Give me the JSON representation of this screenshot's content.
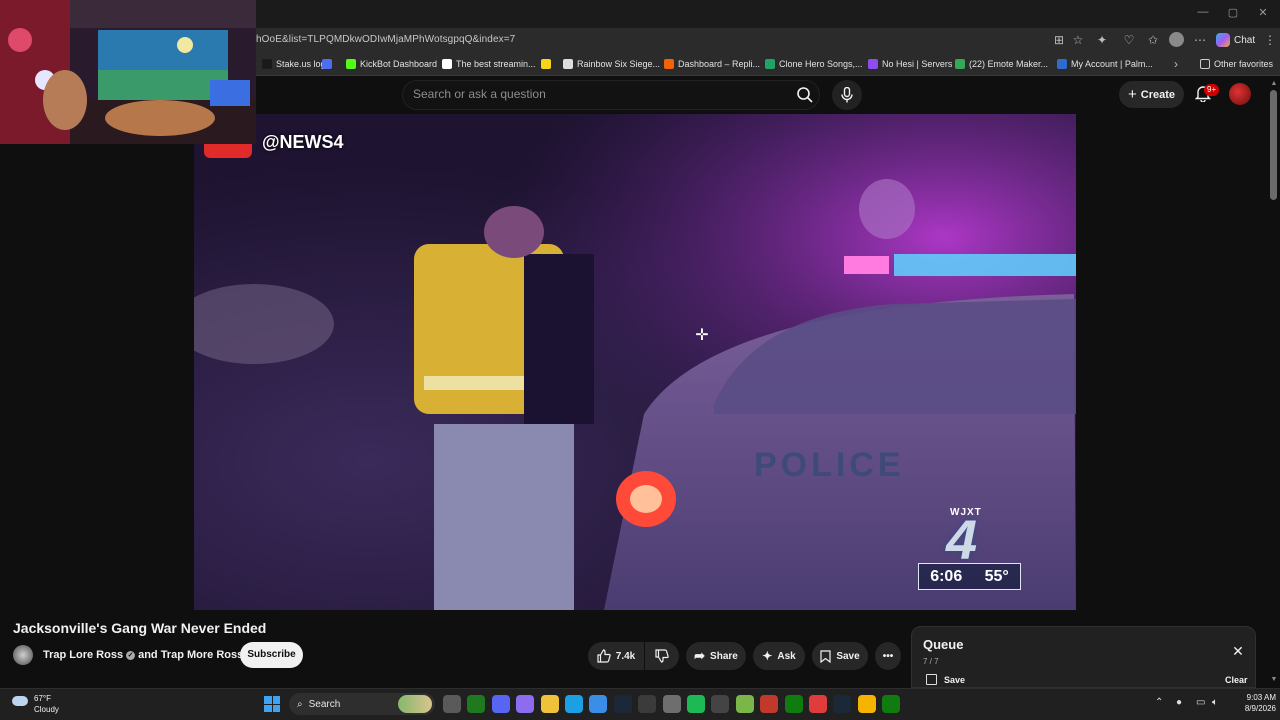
{
  "browser": {
    "url": "hOoE&list=TLPQMDkwODIwMjaMPhWotsgpqQ&index=7",
    "chat_label": "Chat",
    "bookmarks": [
      {
        "label": "Stake.us logo",
        "color": "#1a1a1a"
      },
      {
        "label": "",
        "color": "#4e6ef2"
      },
      {
        "label": "KickBot Dashboard",
        "color": "#53fc18"
      },
      {
        "label": "The best streamin...",
        "color": "#ffffff"
      },
      {
        "label": "",
        "color": "#f7d619"
      },
      {
        "label": "Rainbow Six Siege...",
        "color": "#dddddd"
      },
      {
        "label": "Dashboard – Repli...",
        "color": "#f26207"
      },
      {
        "label": "Clone Hero Songs,...",
        "color": "#21a366"
      },
      {
        "label": "No Hesi | Servers",
        "color": "#8f4cf0"
      },
      {
        "label": "(22) Emote Maker...",
        "color": "#34a853"
      },
      {
        "label": "My Account | Palm...",
        "color": "#2d6bd1"
      }
    ],
    "other_favorites": "Other favorites"
  },
  "youtube": {
    "search_placeholder": "Search or ask a question",
    "create_label": "Create",
    "notif_count": "9+",
    "video": {
      "news_handle": "@NEWS4",
      "station": "WJXT",
      "channel_num": "4",
      "time": "6:06",
      "temp": "55°"
    },
    "title": "Jacksonville's Gang War Never Ended",
    "channel": "Trap Lore Ross",
    "collab": "and Trap More Ross",
    "subscribe_label": "Subscribe",
    "likes": "7.4k",
    "share_label": "Share",
    "ask_label": "Ask",
    "save_label": "Save",
    "queue": {
      "title": "Queue",
      "count": "7 / 7",
      "save_label": "Save",
      "clear_label": "Clear"
    }
  },
  "taskbar": {
    "weather_temp": "67°F",
    "weather_cond": "Cloudy",
    "search_label": "Search",
    "time": "9:03 AM",
    "date": "8/9/2026",
    "apps": [
      {
        "name": "task-view",
        "color": "#5a5a5a"
      },
      {
        "name": "xbox-gamebar",
        "color": "#1f7a1f"
      },
      {
        "name": "discord",
        "color": "#5865f2"
      },
      {
        "name": "copilot",
        "color": "#8c6cf0"
      },
      {
        "name": "file-explorer",
        "color": "#f0c23a"
      },
      {
        "name": "edge",
        "color": "#1ba1e2"
      },
      {
        "name": "ms-store",
        "color": "#3a8ee6"
      },
      {
        "name": "steam",
        "color": "#1b2838"
      },
      {
        "name": "obs",
        "color": "#3b3b3b"
      },
      {
        "name": "settings",
        "color": "#6e6e6e"
      },
      {
        "name": "spotify",
        "color": "#1db954"
      },
      {
        "name": "4k-downloader",
        "color": "#444444"
      },
      {
        "name": "b-app",
        "color": "#7ab648"
      },
      {
        "name": "red-app",
        "color": "#c0392b"
      },
      {
        "name": "xbox",
        "color": "#107c10"
      },
      {
        "name": "g-app",
        "color": "#e03c3c"
      },
      {
        "name": "steam-2",
        "color": "#1b2838"
      },
      {
        "name": "chrome",
        "color": "#f4b400"
      },
      {
        "name": "xbox-2",
        "color": "#107c10"
      }
    ]
  }
}
